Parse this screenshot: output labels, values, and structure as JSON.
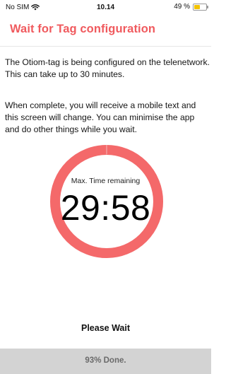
{
  "status_bar": {
    "carrier": "No SIM",
    "time": "10.14",
    "battery_text": "49 %",
    "battery_level": 0.49,
    "wifi_icon": "wifi-icon",
    "battery_color": "#f2c200"
  },
  "header": {
    "title": "Wait for Tag configuration",
    "title_color": "#f05a5e"
  },
  "content": {
    "paragraph1": "The Otiom-tag is being configured on the telenetwork. This can take up to 30 minutes.",
    "paragraph2": "When complete, you will receive a mobile text and this screen will change. You can minimise the app and do other things while you wait."
  },
  "timer": {
    "label": "Max. Time remaining",
    "value": "29:58",
    "ring_color": "#f4696a",
    "remaining_fraction": 0.999
  },
  "footer": {
    "please_wait": "Please Wait",
    "progress_text": "93% Done."
  }
}
